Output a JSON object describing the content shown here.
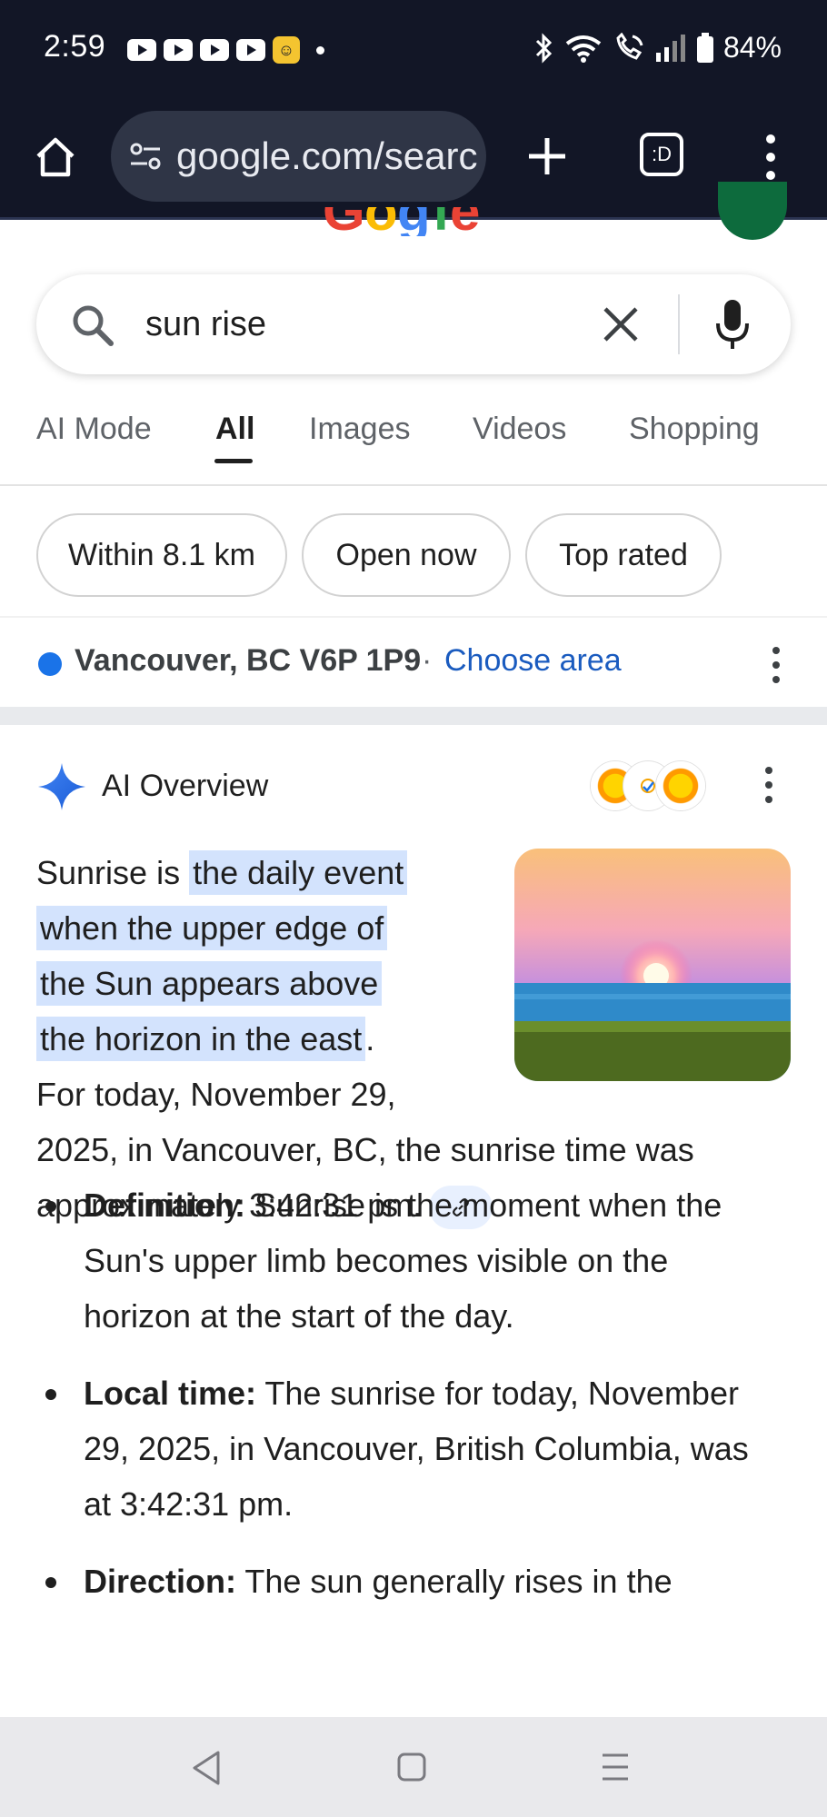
{
  "status_bar": {
    "time": "2:59",
    "battery": "84%",
    "icons": [
      "youtube-icon",
      "youtube-icon",
      "youtube-icon",
      "youtube-icon",
      "notification-app-icon",
      "dot-icon",
      "bluetooth-icon",
      "wifi-icon",
      "wifi-call-icon",
      "signal-icon",
      "battery-icon"
    ]
  },
  "browser": {
    "url": "google.com/searc",
    "tabs_label": ":D"
  },
  "search": {
    "query": "sun rise"
  },
  "tabs": [
    {
      "label": "AI Mode"
    },
    {
      "label": "All"
    },
    {
      "label": "Images"
    },
    {
      "label": "Videos"
    },
    {
      "label": "Shopping"
    }
  ],
  "active_tab": "All",
  "chips": [
    {
      "label": "Within 8.1 km"
    },
    {
      "label": "Open now"
    },
    {
      "label": "Top rated"
    }
  ],
  "location": {
    "text": "Vancouver, BC V6P 1P9",
    "separator": "·",
    "link": "Choose area"
  },
  "ai_overview": {
    "title": "AI Overview",
    "intro_before": "Sunrise is ",
    "intro_highlight_1": "the daily event",
    "intro_highlight_2": "when the upper edge of",
    "intro_highlight_3": "the Sun appears above",
    "intro_highlight_4": "the horizon in the east",
    "intro_after": ".",
    "para_line_1": "For today, November 29,",
    "para_line_2": "2025, in Vancouver, BC, the sunrise time was",
    "para_line_3": "approximately 3:42:31 pm.",
    "bullets": [
      {
        "term": "Definition:",
        "text": " Sunrise is the moment when the Sun's upper limb becomes visible on the horizon at the start of the day."
      },
      {
        "term": "Local time:",
        "text": " The sunrise for today, November 29, 2025, in Vancouver, British Columbia, was at 3:42:31 pm."
      },
      {
        "term": "Direction:",
        "text": " The sun generally rises in the"
      }
    ]
  },
  "colors": {
    "status_bg": "#121626",
    "link_blue": "#1a5bbf",
    "highlight": "#d3e3fd",
    "location_dot": "#1a73e8",
    "nav_bg": "#e9e9ec"
  }
}
